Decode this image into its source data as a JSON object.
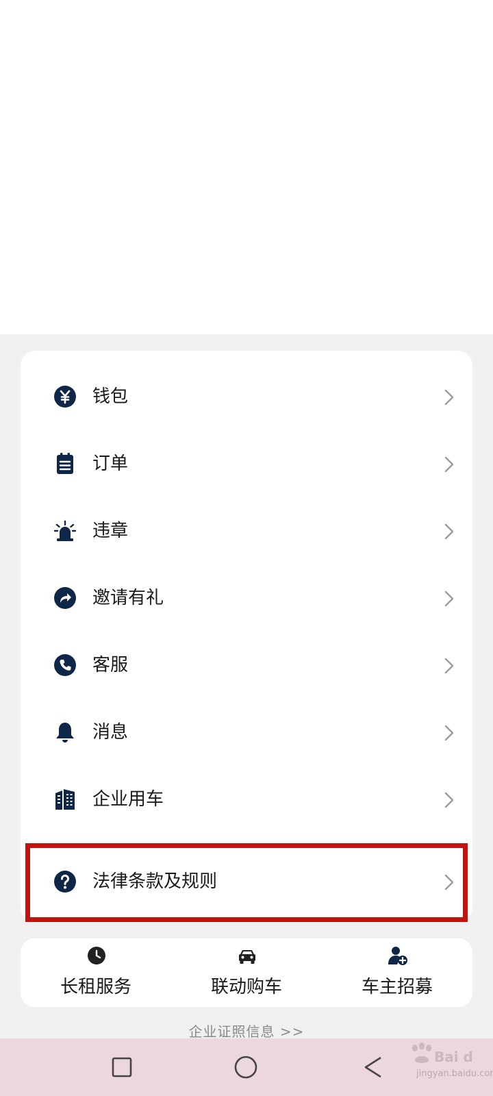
{
  "menu": {
    "items": [
      {
        "label": "钱包",
        "icon": "yuan-icon"
      },
      {
        "label": "订单",
        "icon": "notepad-icon"
      },
      {
        "label": "违章",
        "icon": "siren-icon"
      },
      {
        "label": "邀请有礼",
        "icon": "share-icon"
      },
      {
        "label": "客服",
        "icon": "phone-icon"
      },
      {
        "label": "消息",
        "icon": "bell-icon"
      },
      {
        "label": "企业用车",
        "icon": "building-icon"
      },
      {
        "label": "法律条款及规则",
        "icon": "question-icon"
      }
    ]
  },
  "services": [
    {
      "label": "长租服务",
      "icon": "clock-icon"
    },
    {
      "label": "联动购车",
      "icon": "car-icon"
    },
    {
      "label": "车主招募",
      "icon": "add-user-icon"
    }
  ],
  "footer": {
    "license_link": "企业证照信息 >>"
  },
  "watermark": {
    "text": "jingyan.baidu.com"
  },
  "colors": {
    "icon": "#0e2749",
    "highlight": "#c0140f",
    "nav_bar": "#ecd7dc"
  }
}
